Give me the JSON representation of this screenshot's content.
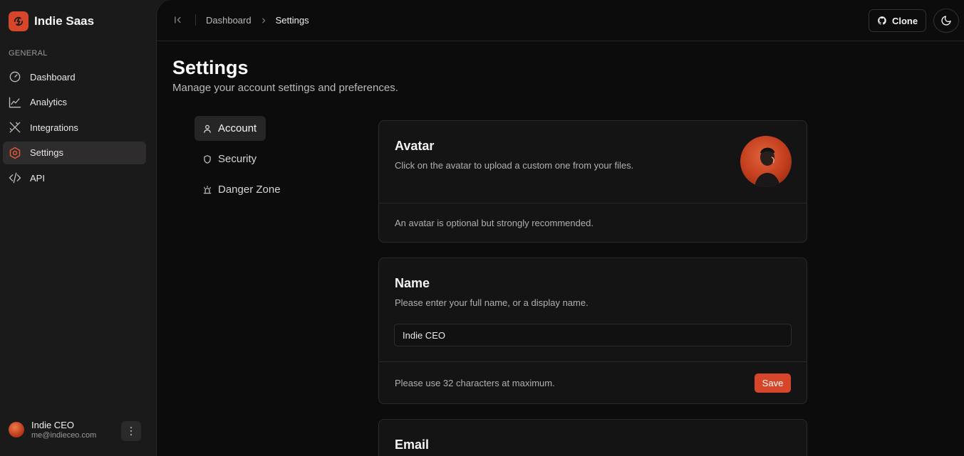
{
  "brand": {
    "name": "Indie Saas",
    "logo_icon": "bolt-icon",
    "accent": "#d6462a"
  },
  "sidebar": {
    "section_label": "GENERAL",
    "items": [
      {
        "label": "Dashboard",
        "icon": "gauge-icon",
        "active": false
      },
      {
        "label": "Analytics",
        "icon": "line-chart-icon",
        "active": false
      },
      {
        "label": "Integrations",
        "icon": "tools-icon",
        "active": false
      },
      {
        "label": "Settings",
        "icon": "hexagon-settings-icon",
        "active": true
      },
      {
        "label": "API",
        "icon": "code-icon",
        "active": false
      }
    ],
    "user": {
      "name": "Indie CEO",
      "email": "me@indieceo.com"
    }
  },
  "topbar": {
    "breadcrumb": {
      "parent": "Dashboard",
      "current": "Settings"
    },
    "clone_label": "Clone"
  },
  "page": {
    "title": "Settings",
    "subtitle": "Manage your account settings and preferences."
  },
  "tabs": [
    {
      "label": "Account",
      "icon": "user-icon",
      "active": true
    },
    {
      "label": "Security",
      "icon": "shield-icon",
      "active": false
    },
    {
      "label": "Danger Zone",
      "icon": "siren-icon",
      "active": false
    }
  ],
  "avatar_card": {
    "title": "Avatar",
    "description": "Click on the avatar to upload a custom one from your files.",
    "footer": "An avatar is optional but strongly recommended."
  },
  "name_card": {
    "title": "Name",
    "description": "Please enter your full name, or a display name.",
    "value": "Indie CEO",
    "footer": "Please use 32 characters at maximum.",
    "save_label": "Save"
  },
  "email_card": {
    "title": "Email"
  }
}
